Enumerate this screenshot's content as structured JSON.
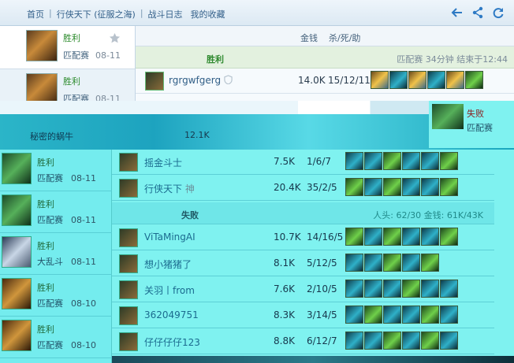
{
  "breadcrumb": [
    "首页",
    "行侠天下 (征服之海)",
    "战斗日志",
    "我的收藏"
  ],
  "header": {
    "gold_label": "金钱",
    "kda_label": "杀/死/助"
  },
  "left_list": [
    {
      "result": "胜利",
      "mode": "匹配赛",
      "date": "08-11",
      "selected": true
    },
    {
      "result": "胜利",
      "mode": "匹配赛",
      "date": "08-11",
      "selected": false
    }
  ],
  "left_list_glitch": [
    {
      "result": "胜利",
      "mode": "匹配赛",
      "date": "08-11"
    },
    {
      "result": "胜利",
      "mode": "匹配赛",
      "date": "08-11"
    },
    {
      "result": "胜利",
      "mode": "大乱斗",
      "date": "08-11"
    },
    {
      "result": "胜利",
      "mode": "匹配赛",
      "date": "08-10"
    },
    {
      "result": "胜利",
      "mode": "匹配赛",
      "date": "08-10"
    }
  ],
  "win_team": {
    "label": "胜利",
    "meta": "匹配赛 34分钟 结束于12:44"
  },
  "players_win": [
    {
      "name": "rgrgwfgerg",
      "gold": "14.0K",
      "kda": "15/12/11"
    },
    {
      "name": "摇金斗士",
      "gold": "7.5K",
      "kda": "1/6/7"
    },
    {
      "name": "行侠天下",
      "gold": "20.4K",
      "kda": "35/2/5",
      "title": "神"
    }
  ],
  "band": {
    "name": "秘密的蜗牛",
    "gold": "12.1K"
  },
  "lose_team": {
    "label": "失败",
    "meta": "人头: 62/30 金钱: 61K/43K"
  },
  "players_lose": [
    {
      "name": "ViTaMingAI",
      "gold": "10.7K",
      "kda": "14/16/5"
    },
    {
      "name": "想小猪猪了",
      "gold": "8.1K",
      "kda": "5/12/5"
    },
    {
      "name": "关羽丨from",
      "gold": "7.6K",
      "kda": "2/10/5"
    },
    {
      "name": "362049751",
      "gold": "8.3K",
      "kda": "3/14/5"
    },
    {
      "name": "仔仔仔仔123",
      "gold": "8.8K",
      "kda": "6/12/7"
    }
  ],
  "side_card": {
    "result": "失败",
    "mode": "匹配赛"
  },
  "icons": [
    "back-arrow-icon",
    "share-icon",
    "refresh-icon",
    "star-icon",
    "shield-icon"
  ]
}
